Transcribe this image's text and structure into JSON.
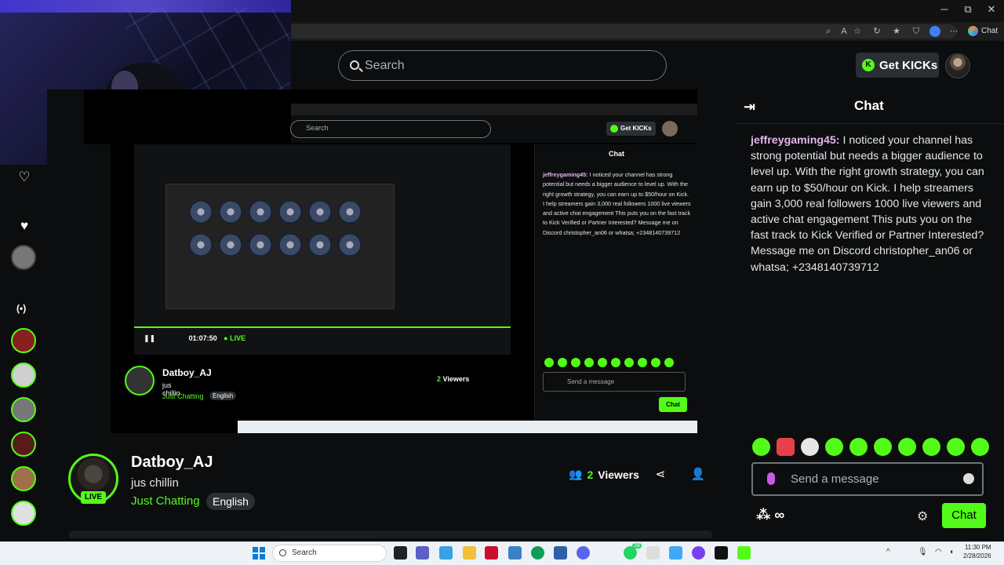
{
  "browser": {
    "window_minimize": "─",
    "window_maximize": "⧉",
    "window_close": "✕",
    "copilot_label": "Chat"
  },
  "header": {
    "search_placeholder": "Search",
    "get_kicks_label": "Get KICKs"
  },
  "webcam": {
    "description_icon": "webcam-overlay"
  },
  "nested_stream": {
    "search_placeholder": "Search",
    "get_kicks_label": "Get KICKs",
    "chat_title": "Chat",
    "chat_user": "jeffreygaming45:",
    "chat_text": "I noticed your channel has strong potential but needs a bigger audience to level up. With the right growth strategy, you can earn up to $50/hour on Kick. I help streamers gain 3,000 real followers 1000 live viewers and active chat engagement This puts you on the fast track to Kick Verified or Partner Interested? Message me on Discord christopher_an06 or whatsa; +2348140739712",
    "time": "01:07:50",
    "live": "● LIVE",
    "streamer": "Datboy_AJ",
    "title": "jus chillin",
    "category": "Just Chatting",
    "language": "English",
    "viewers_count": "2",
    "viewers_label": "Viewers",
    "message_placeholder": "Send a message",
    "chat_button": "Chat",
    "live_badge": "LIVE"
  },
  "streamer_info": {
    "name": "Datboy_AJ",
    "title": "jus chillin",
    "category": "Just Chatting",
    "language": "English",
    "live_badge": "LIVE",
    "viewers_count": "2",
    "viewers_label": "Viewers"
  },
  "chat": {
    "title": "Chat",
    "messages": [
      {
        "user": "jeffreygaming45:",
        "text": " I noticed your channel has strong potential but needs a bigger audience to level up. With the right growth strategy, you can earn up to $50/hour on Kick. I help streamers gain 3,000 real followers 1000 live viewers and active chat engagement This puts you on the fast track to Kick Verified or Partner Interested? Message me on Discord christopher_an06 or whatsa; +2348140739712"
      }
    ],
    "message_placeholder": "Send a message",
    "send_button": "Chat"
  },
  "taskbar": {
    "search_placeholder": "Search",
    "time": "11:30 PM",
    "date": "2/28/2026",
    "whatsapp_badge": "28"
  },
  "colors": {
    "kick_green": "#53fc18",
    "background": "#0b0d0e",
    "username": "#e5b6ea"
  }
}
